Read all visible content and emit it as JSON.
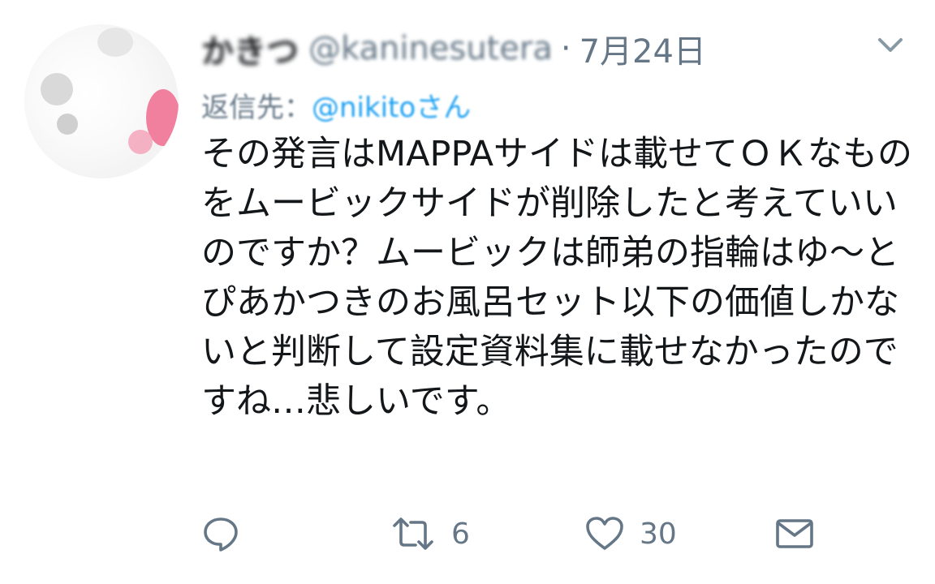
{
  "tweet": {
    "author": {
      "display_name": "かきつ",
      "handle": "@kaninesutera"
    },
    "separator": "·",
    "date": "7月24日",
    "reply": {
      "prefix": "返信先：",
      "handle": "@nikitoさん"
    },
    "text": "その発言はMAPPAサイドは載せてＯＫなものをムービックサイドが削除したと考えていいのですか？ムービックは師弟の指輪はゆ〜とぴあかつきのお風呂セット以下の価値しかないと判断して設定資料集に載せなかったのですね…悲しいです。"
  },
  "actions": {
    "reply": {
      "icon": "reply-icon"
    },
    "retweet": {
      "icon": "retweet-icon",
      "count": "6"
    },
    "like": {
      "icon": "heart-icon",
      "count": "30"
    },
    "message": {
      "icon": "envelope-icon"
    }
  },
  "colors": {
    "text": "#14171a",
    "secondary": "#657786",
    "link": "#1da1f2"
  }
}
